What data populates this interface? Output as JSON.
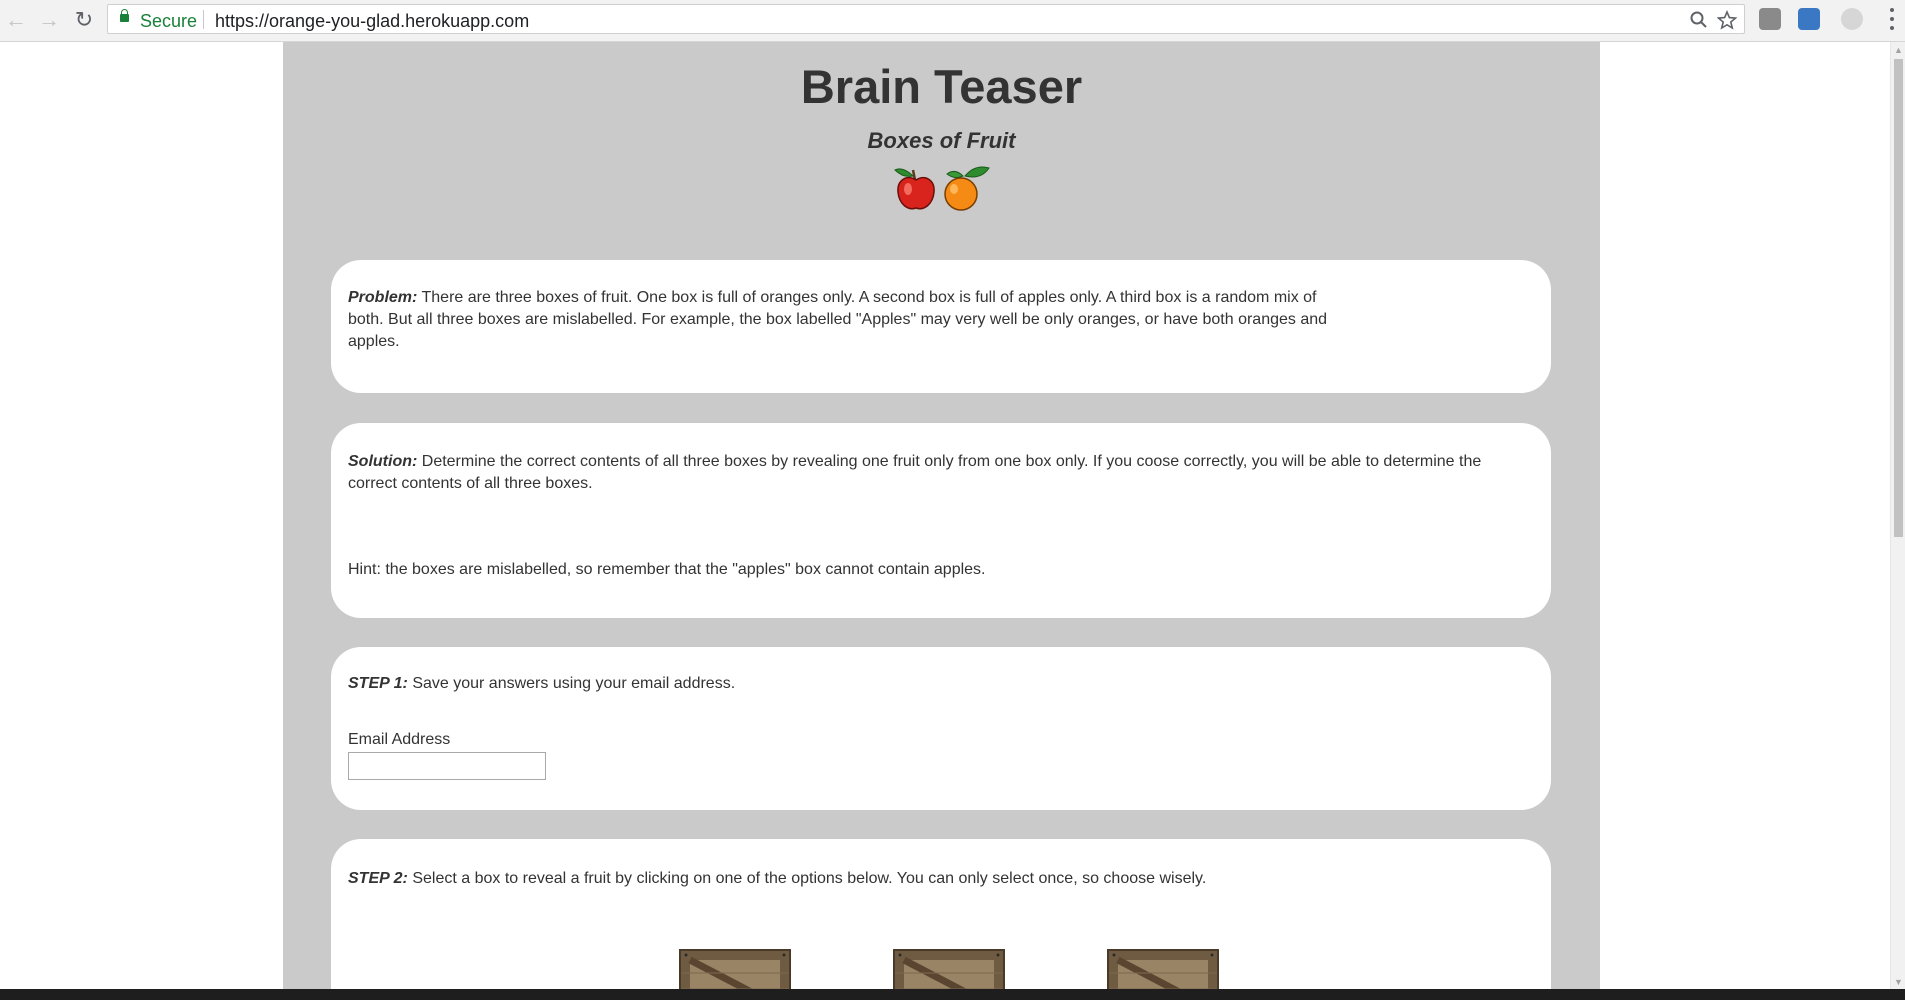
{
  "browser": {
    "secure_label": "Secure",
    "url": "https://orange-you-glad.herokuapp.com"
  },
  "page": {
    "title": "Brain Teaser",
    "subtitle": "Boxes of Fruit",
    "fruit_icons": [
      "apple-icon",
      "orange-icon"
    ]
  },
  "problem": {
    "label": "Problem:",
    "text": " There are three boxes of fruit. One box is full of oranges only. A second box is full of apples only. A third box is a random mix of both. But all three boxes are mislabelled. For example, the box labelled \"Apples\" may very well be only oranges, or have both oranges and apples."
  },
  "solution": {
    "label": "Solution:",
    "text": " Determine the correct contents of all three boxes by revealing one fruit only from one box only. If you coose correctly, you will be able to determine the correct contents of all three boxes.",
    "hint": "Hint: the boxes are mislabelled, so remember that the \"apples\" box cannot contain apples."
  },
  "step1": {
    "label": "STEP 1:",
    "text": " Save your answers using your email address.",
    "email_label": "Email Address",
    "email_value": ""
  },
  "step2": {
    "label": "STEP 2:",
    "text": " Select a box to reveal a fruit by clicking on one of the options below. You can only select once, so choose wisely.",
    "boxes": [
      "crate-icon",
      "crate-icon",
      "crate-icon"
    ]
  },
  "colors": {
    "page_bg": "#cacaca",
    "card_bg": "#ffffff",
    "text": "#333333",
    "secure_green": "#188038"
  }
}
